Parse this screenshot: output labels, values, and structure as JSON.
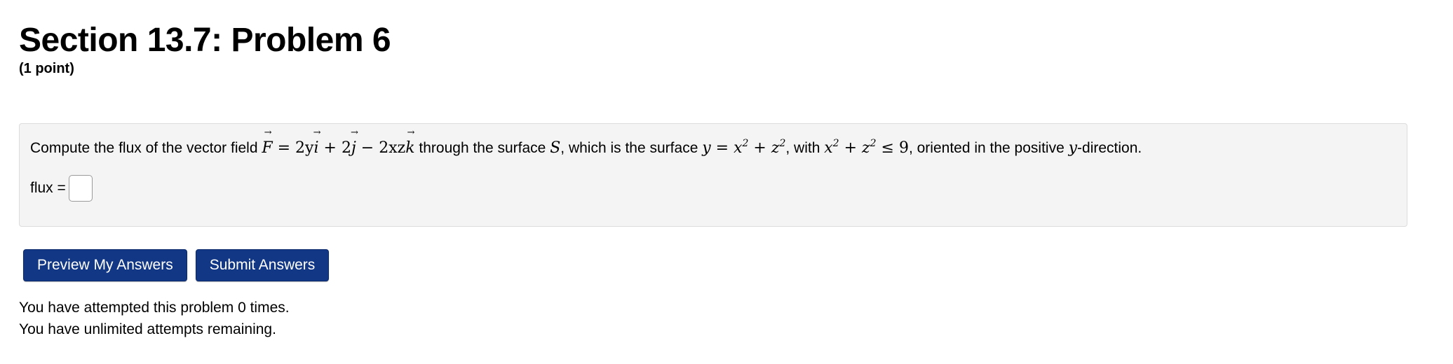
{
  "header": {
    "title": "Section 13.7: Problem 6",
    "points": "(1 point)"
  },
  "problem": {
    "intro": "Compute the flux of the vector field",
    "through_text": "through the surface",
    "which_text": ", which is the surface",
    "with_text": ", with",
    "oriented_text": ", oriented in the positive",
    "direction_text": "-direction.",
    "math": {
      "F": "F",
      "eq1": "= 2y",
      "i": "i",
      "plus2": "+ 2",
      "j": "j",
      "minus": "− 2xz",
      "k": "k",
      "S": "S",
      "surface_lhs": "y = x",
      "surface_plus": "+ z",
      "exp": "2",
      "region_x": "x",
      "region_plus": "+ z",
      "region_le": "≤ 9",
      "ydir": "y"
    }
  },
  "answer": {
    "label": "flux =",
    "value": "",
    "placeholder": ""
  },
  "buttons": {
    "preview": "Preview My Answers",
    "submit": "Submit Answers"
  },
  "attempts": {
    "line1": "You have attempted this problem 0 times.",
    "line2": "You have unlimited attempts remaining."
  },
  "colors": {
    "button_bg": "#123785",
    "panel_bg": "#f4f4f4"
  }
}
